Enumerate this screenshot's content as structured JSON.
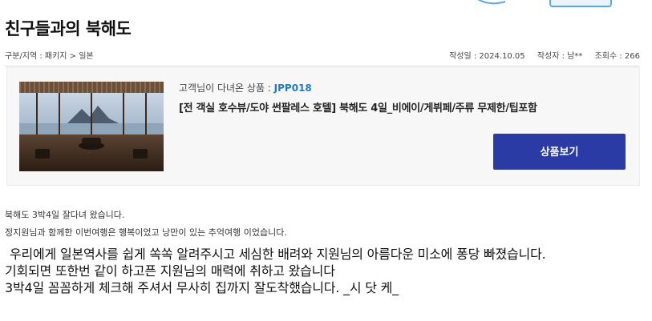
{
  "post": {
    "title": "친구들과의 북해도",
    "category": "구분/지역 : 패키지 > 일본",
    "date": "작성일 : 2024.10.05",
    "author": "작성자 : 남**",
    "views": "조회수 : 266"
  },
  "product": {
    "code_label": "고객님이 다녀온 상품 : ",
    "code": "JPP018",
    "name": "[전 객실 호수뷰/도야 썬팔레스 호텔] 북해도 4일_비에이/게뷔페/주류 무제한/팁포함",
    "button_label": "상품보기",
    "image_alt": "hotel-lounge-lake-view"
  },
  "review": {
    "lines": [
      "북해도 3박4일 잘다녀 왔습니다.",
      "정지원님과 함께한 이번여행은 행복이었고 낭만이 있는 추억여행 이었습니다.",
      "우리에게 일본역사를 쉽게 쏙쏙 알려주시고 세심한 배려와 지원님의 아름다운 미소에 퐁당 빠졌습니다.",
      "기회되면 또한번 같이 하고픈 지원님의 매력에 취하고 왔습니다",
      "3박4일 꼼꼼하게 체크해 주셔서 무사히 집까지 잘도착했습니다.   _시 닷 케_"
    ]
  },
  "colors": {
    "accent_blue": "#2a3ba6",
    "code_blue": "#1d7bd6"
  }
}
